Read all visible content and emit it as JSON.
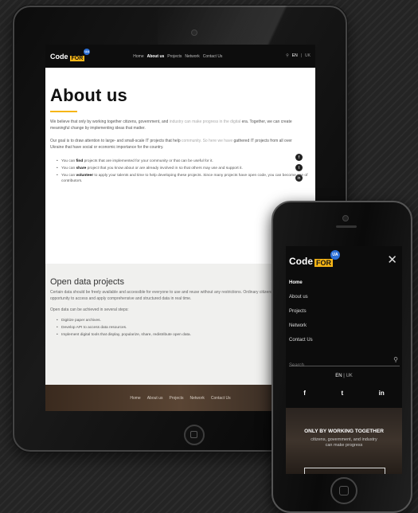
{
  "tablet": {
    "logo": {
      "code": "Code",
      "for": "FOR",
      "ua": "UA"
    },
    "nav": [
      "Home",
      "About us",
      "Projects",
      "Network",
      "Contact Us"
    ],
    "lang_en": "EN",
    "lang_uk": "UK",
    "page_title": "About us",
    "para1_a": "We believe that only by working together citizens, government, and ",
    "para1_b": "industry can make progress in the digital",
    "para1_c": "era. Together, we can create meaningful change by implementing ideas that matter.",
    "para2_a": "Our goal is to draw attention to large- and small-scale IT projects that help ",
    "para2_b": "community. So here we have",
    "para2_c": "gathered IT projects from all over Ukraine that have social or economic importance for the country.",
    "list": [
      {
        "pre": "You can ",
        "bold": "find",
        "post": " projects that are implemented for your community or that can be useful for it."
      },
      {
        "pre": "You can ",
        "bold": "share",
        "post": " project that you know about or are already involved in so that others may use and support it."
      },
      {
        "pre": "You can ",
        "bold": "volunteer",
        "post": " to apply your talents and time to help developing these projects. Since many projects have open code, you can become one of contributors."
      }
    ],
    "social": [
      "f",
      "t",
      "in"
    ],
    "open_data_title": "Open data projects",
    "open_para": "Certain data should be freely available and accessible for everyone to use and reuse without any restrictions. Ordinary citizens should be given opportunity to access and apply comprehensive and structured data in real time.",
    "open_steps_intro": "Open data can be achieved in several steps:",
    "steps": [
      "Digitize paper archives.",
      "Develop API to access data resources.",
      "Implement digital tools that display, popularize, share, redistribute open data."
    ],
    "footer_nav": [
      "Home",
      "About us",
      "Projects",
      "Network",
      "Contact Us"
    ]
  },
  "phone": {
    "logo": {
      "code": "Code",
      "for": "FOR",
      "ua": "UA"
    },
    "menu": [
      "Home",
      "About us",
      "Projects",
      "Network",
      "Contact Us"
    ],
    "search_placeholder": "Search",
    "lang_en": "EN",
    "lang_uk": "UK",
    "social": [
      "f",
      "t",
      "in"
    ],
    "banner_title": "ONLY BY WORKING TOGETHER",
    "banner_line1": "citizens, government, and industry",
    "banner_line2": "can make progress"
  },
  "colors": {
    "accent": "#f6b516",
    "ua_badge": "#2b6fd6",
    "header_bg": "#0d0d0d"
  }
}
